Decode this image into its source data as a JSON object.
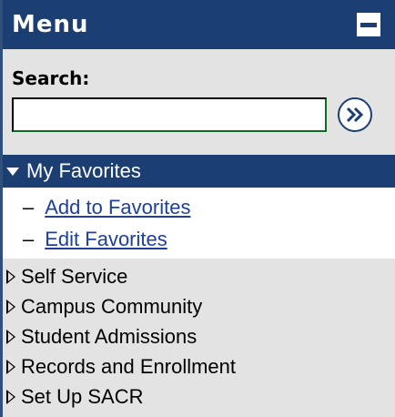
{
  "menu": {
    "title": "Menu",
    "collapse_icon": "minus-icon"
  },
  "search": {
    "label": "Search:",
    "value": "",
    "placeholder": "",
    "go_icon": "double-chevron-right-icon"
  },
  "favorites": {
    "label": "My Favorites",
    "items": [
      {
        "dash": "–",
        "label": "Add to Favorites"
      },
      {
        "dash": "–",
        "label": "Edit Favorites"
      }
    ]
  },
  "nav": {
    "items": [
      {
        "label": "Self Service"
      },
      {
        "label": "Campus Community"
      },
      {
        "label": "Student Admissions"
      },
      {
        "label": "Records and Enrollment"
      },
      {
        "label": "Set Up SACR"
      }
    ]
  },
  "colors": {
    "header_bg": "#1b3f73",
    "panel_bg": "#e3e3e3",
    "link": "#1c3fa0"
  }
}
